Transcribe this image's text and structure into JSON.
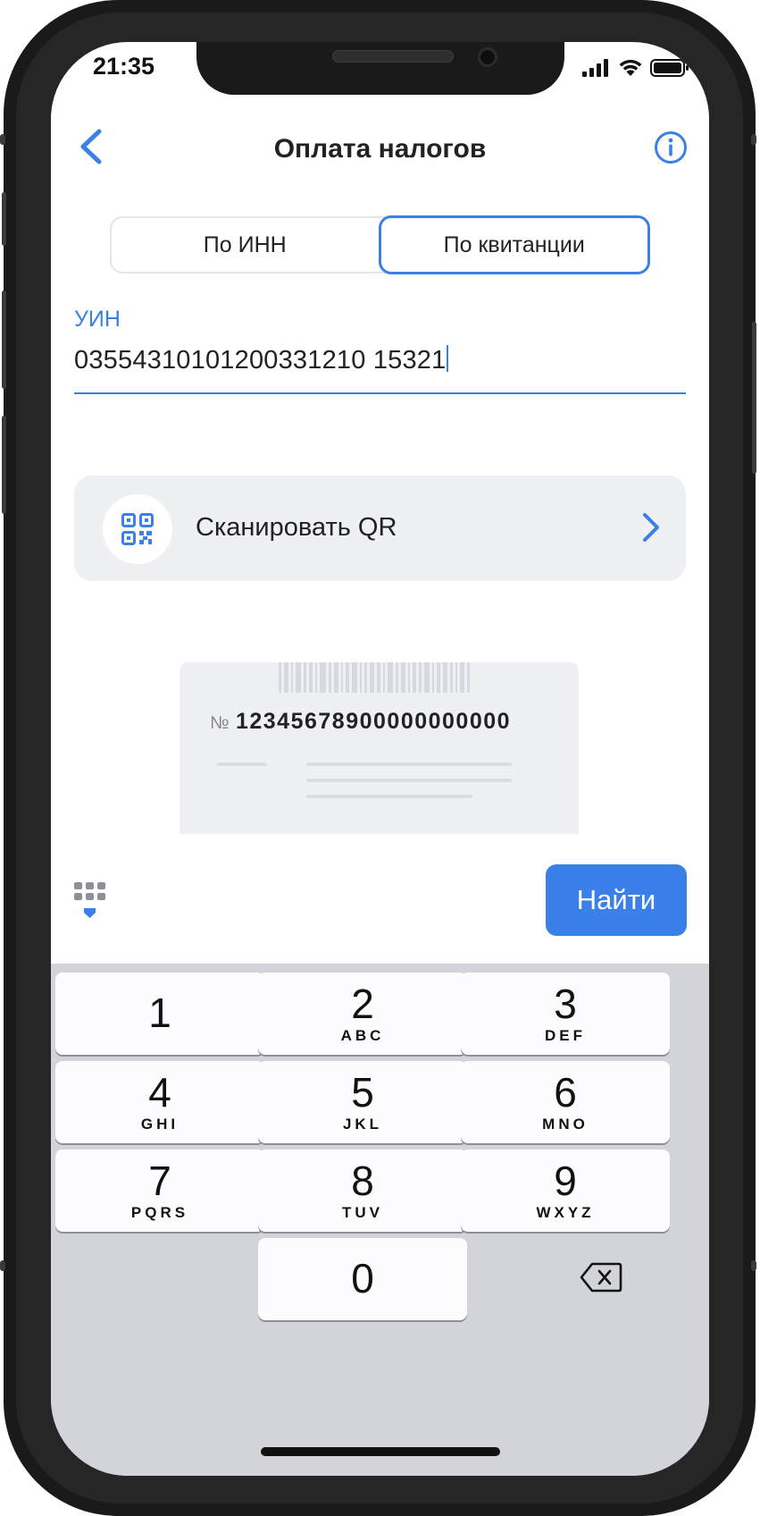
{
  "status_bar": {
    "time": "21:35"
  },
  "nav": {
    "title": "Оплата налогов"
  },
  "segment": {
    "tab_inn": "По ИНН",
    "tab_receipt": "По квитанции",
    "active": "tab_receipt"
  },
  "uin": {
    "label": "УИН",
    "value": "03554310101200331210 15321"
  },
  "qr": {
    "label": "Сканировать QR"
  },
  "receipt": {
    "prefix": "№",
    "number": "12345678900000000000"
  },
  "actions": {
    "find_label": "Найти"
  },
  "keyboard": {
    "keys": [
      {
        "digit": "1",
        "letters": ""
      },
      {
        "digit": "2",
        "letters": "ABC"
      },
      {
        "digit": "3",
        "letters": "DEF"
      },
      {
        "digit": "4",
        "letters": "GHI"
      },
      {
        "digit": "5",
        "letters": "JKL"
      },
      {
        "digit": "6",
        "letters": "MNO"
      },
      {
        "digit": "7",
        "letters": "PQRS"
      },
      {
        "digit": "8",
        "letters": "TUV"
      },
      {
        "digit": "9",
        "letters": "WXYZ"
      },
      {
        "digit": "0",
        "letters": ""
      }
    ]
  },
  "icons": {
    "back": "chevron-left-icon",
    "info": "info-icon",
    "qr": "qr-code-icon",
    "chevron": "chevron-right-icon",
    "keyboard_toggle": "keyboard-hide-icon",
    "delete": "backspace-icon"
  },
  "colors": {
    "accent": "#3b80e8",
    "card_bg": "#eff0f3",
    "keyboard_bg": "#d2d4d9"
  }
}
